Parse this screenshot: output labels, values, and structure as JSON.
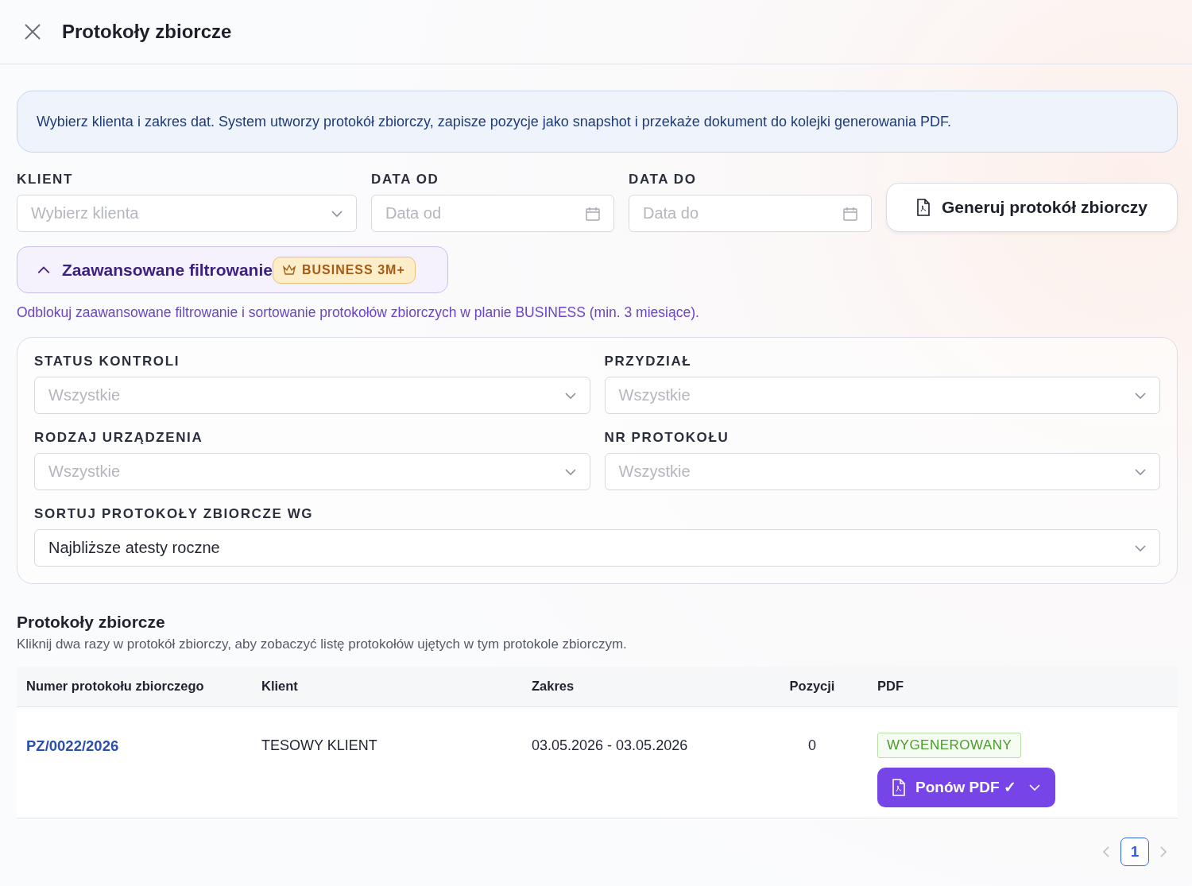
{
  "window": {
    "title": "Protokoły zbiorcze"
  },
  "info": "Wybierz klienta i zakres dat. System utworzy protokół zbiorczy, zapisze pozycje jako snapshot i przekaże dokument do kolejki generowania PDF.",
  "fields": [
    {
      "label": "KLIENT",
      "placeholder": "Wybierz klienta",
      "kind": "select"
    },
    {
      "label": "DATA OD",
      "placeholder": "Data od",
      "kind": "date"
    },
    {
      "label": "DATA DO",
      "placeholder": "Data do",
      "kind": "date"
    }
  ],
  "generate_button": "Generuj protokół zbiorczy",
  "advanced": {
    "label": "Zaawansowane filtrowanie",
    "expanded": true,
    "badge": "BUSINESS 3M+",
    "note": "Odblokuj zaawansowane filtrowanie i sortowanie protokołów zbiorczych w planie BUSINESS (min. 3 miesiące)."
  },
  "filters": [
    {
      "label": "STATUS KONTROLI",
      "placeholder": "Wszystkie"
    },
    {
      "label": "PRZYDZIAŁ",
      "placeholder": "Wszystkie"
    },
    {
      "label": "RODZAJ URZĄDZENIA",
      "placeholder": "Wszystkie"
    },
    {
      "label": "NR PROTOKOŁU",
      "placeholder": "Wszystkie"
    },
    {
      "label": "SORTUJ PROTOKOŁY ZBIORCZE WG",
      "value": "Najbliższe atesty roczne",
      "wide": true
    }
  ],
  "list": {
    "title": "Protokoły zbiorcze",
    "subtitle": "Kliknij dwa razy w protokół zbiorczy, aby zobaczyć listę protokołów ujętych w tym protokole zbiorczym."
  },
  "table": {
    "columns": [
      "Numer protokołu zbiorczego",
      "Klient",
      "Zakres",
      "Pozycji",
      "PDF"
    ],
    "rows": [
      {
        "number": "PZ/0022/2026",
        "client": "TESOWY KLIENT",
        "range": "03.05.2026 - 03.05.2026",
        "count": "0",
        "status": "WYGENEROWANY",
        "action": "Ponów PDF ✓"
      }
    ]
  },
  "pagination": {
    "pages": [
      {
        "label": "1",
        "selected": true
      }
    ]
  }
}
